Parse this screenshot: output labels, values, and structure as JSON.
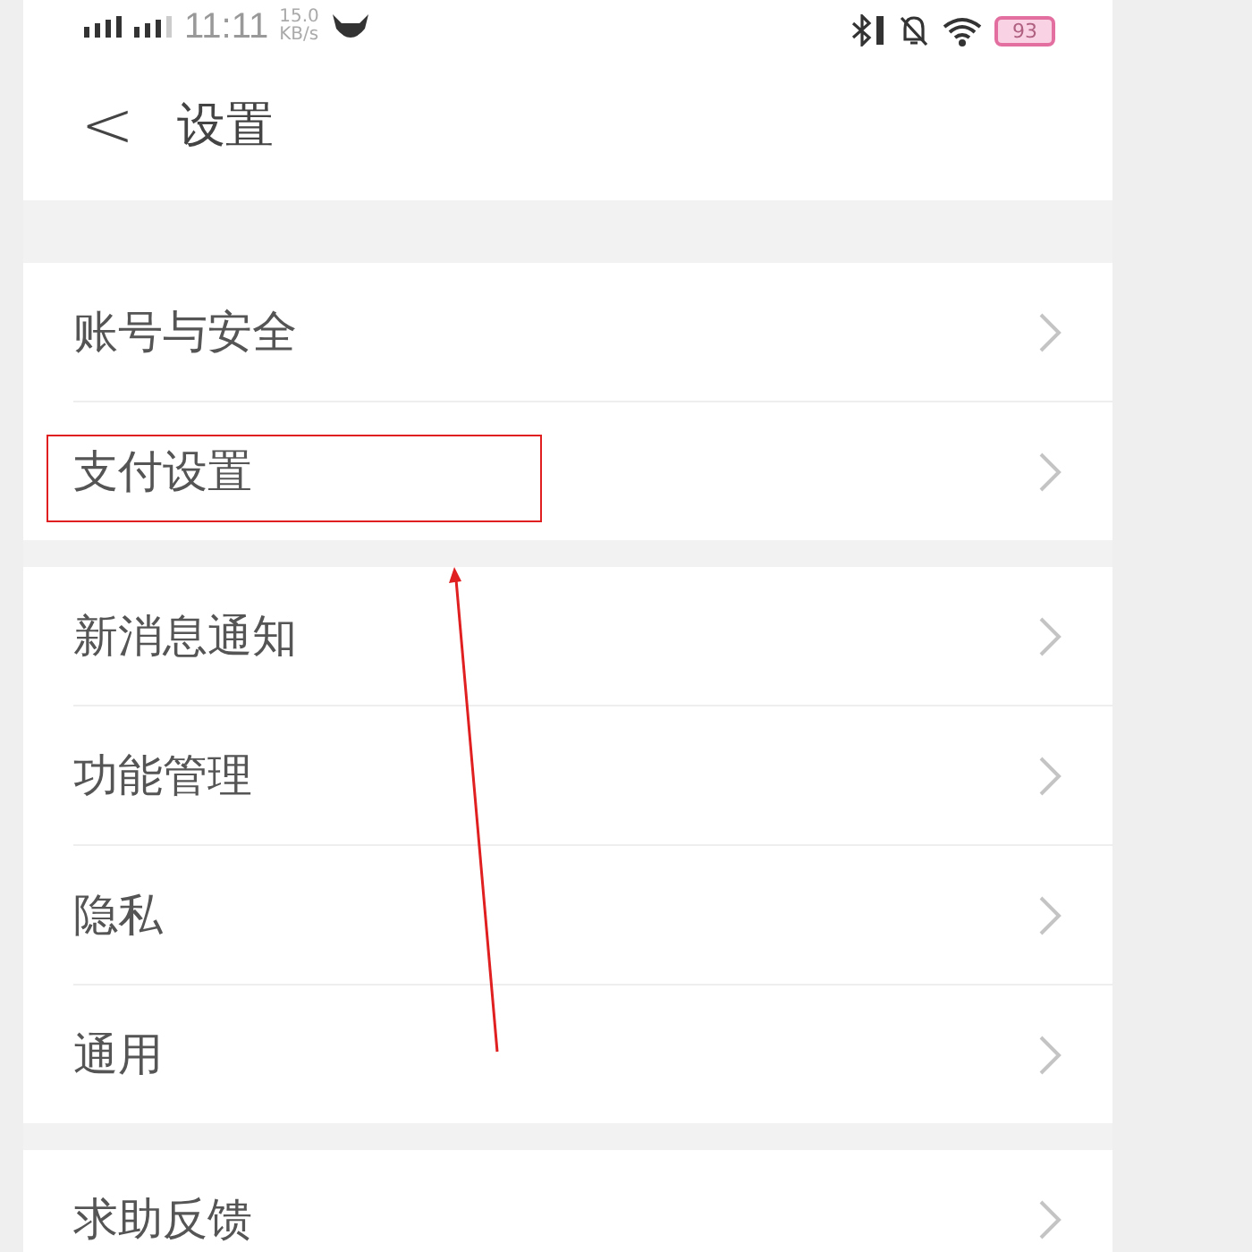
{
  "status_bar": {
    "time": "11:11",
    "speed": "15.0",
    "speed_unit": "KB/s",
    "battery": "93"
  },
  "header": {
    "back": "<",
    "title": "设置"
  },
  "groups": [
    {
      "items": [
        {
          "label": "账号与安全",
          "highlighted": false
        },
        {
          "label": "支付设置",
          "highlighted": true
        }
      ]
    },
    {
      "items": [
        {
          "label": "新消息通知",
          "highlighted": false
        },
        {
          "label": "功能管理",
          "highlighted": false
        },
        {
          "label": "隐私",
          "highlighted": false
        },
        {
          "label": "通用",
          "highlighted": false
        }
      ]
    },
    {
      "items": [
        {
          "label": "求助反馈",
          "highlighted": false
        }
      ]
    }
  ]
}
